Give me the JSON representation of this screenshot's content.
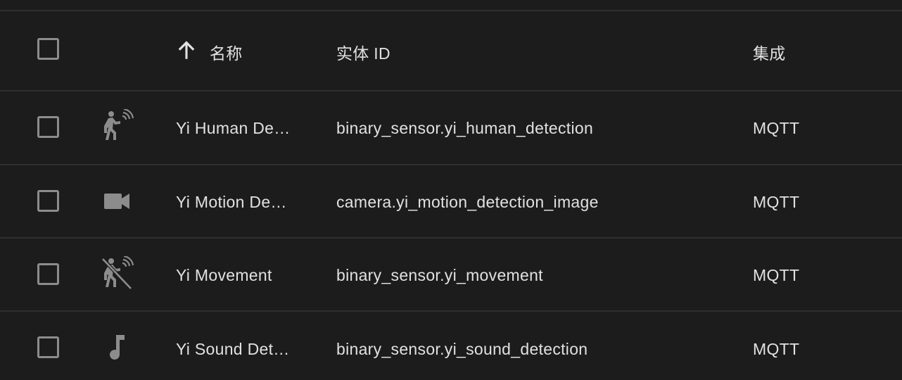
{
  "header": {
    "name_label": "名称",
    "entity_id_label": "实体 ID",
    "integration_label": "集成"
  },
  "rows": [
    {
      "icon": "motion-sensor-icon",
      "name": "Yi Human De…",
      "entity_id": "binary_sensor.yi_human_detection",
      "integration": "MQTT"
    },
    {
      "icon": "video-camera-icon",
      "name": "Yi Motion De…",
      "entity_id": "camera.yi_motion_detection_image",
      "integration": "MQTT"
    },
    {
      "icon": "motion-sensor-off-icon",
      "name": "Yi Movement",
      "entity_id": "binary_sensor.yi_movement",
      "integration": "MQTT"
    },
    {
      "icon": "music-note-icon",
      "name": "Yi Sound Det…",
      "entity_id": "binary_sensor.yi_sound_detection",
      "integration": "MQTT"
    }
  ],
  "colors": {
    "background": "#1c1c1c",
    "divider": "#2f2f2f",
    "text": "#e1e1e1",
    "icon": "#8c8c8c"
  }
}
